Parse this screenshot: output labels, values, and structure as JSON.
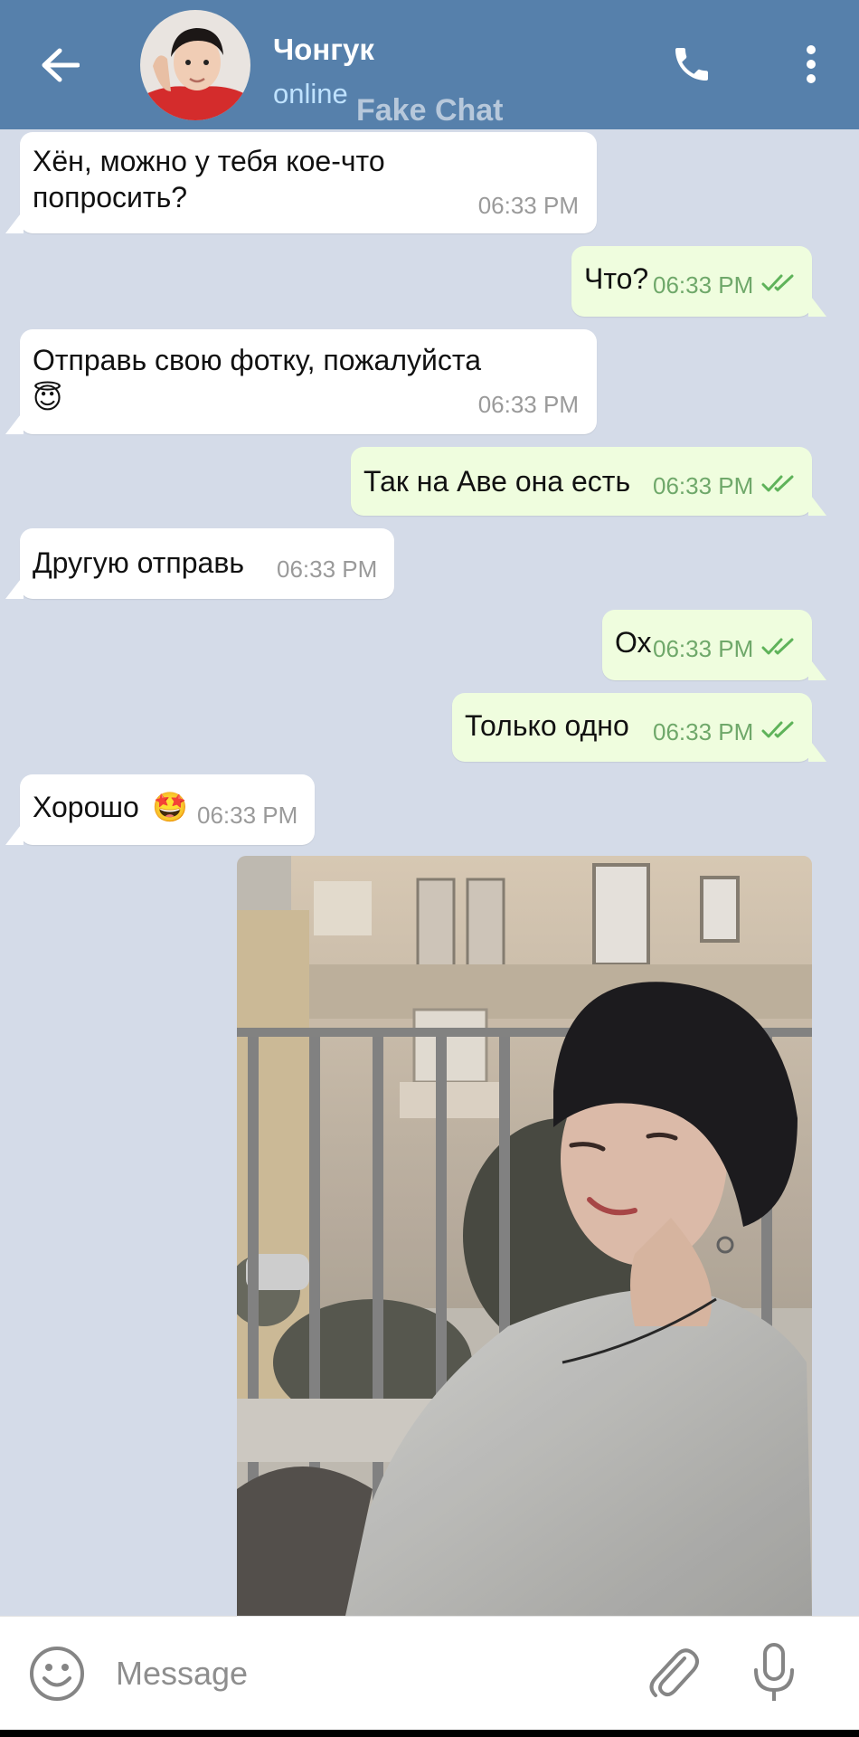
{
  "header": {
    "contact_name": "Чонгук",
    "status": "online",
    "watermark": "Fake Chat",
    "icons": {
      "back": "arrow-left-icon",
      "call": "phone-icon",
      "menu": "more-vert-icon"
    },
    "colors": {
      "bar": "#5680ab",
      "status": "#bfe2ff"
    }
  },
  "messages": [
    {
      "dir": "in",
      "text": "Хён, можно у тебя кое-что попросить?",
      "time": "06:33 PM"
    },
    {
      "dir": "out",
      "text": "Что?",
      "time": "06:33 PM",
      "read": true
    },
    {
      "dir": "in",
      "text": "Отправь свою фотку, пожалуйста 😇",
      "time": "06:33 PM"
    },
    {
      "dir": "out",
      "text": "Так на Аве она есть",
      "time": "06:33 PM",
      "read": true
    },
    {
      "dir": "in",
      "text": "Другую отправь",
      "time": "06:33 PM"
    },
    {
      "dir": "out",
      "text": "Ох",
      "time": "06:33 PM",
      "read": true
    },
    {
      "dir": "out",
      "text": "Только одно",
      "time": "06:33 PM",
      "read": true
    },
    {
      "dir": "in",
      "text": "Хорошо 🤩",
      "time": "06:33 PM"
    },
    {
      "dir": "out",
      "type": "photo"
    }
  ],
  "msg": {
    "m1_line1": "Хён, можно у тебя кое-что",
    "m1_line2": "попросить?",
    "m3_line1": "Отправь свою фотку, пожалуйста",
    "m3_emoji": "😇",
    "m8_text": "Хорошо",
    "m8_emoji": "🤩"
  },
  "composer": {
    "placeholder": "Message",
    "icons": {
      "emoji": "smiley-icon",
      "attach": "paperclip-icon",
      "mic": "microphone-icon"
    }
  },
  "colors": {
    "chat_bg": "#d4dbe8",
    "incoming": "#ffffff",
    "outgoing": "#effdde",
    "read_check": "#5fb35a"
  }
}
